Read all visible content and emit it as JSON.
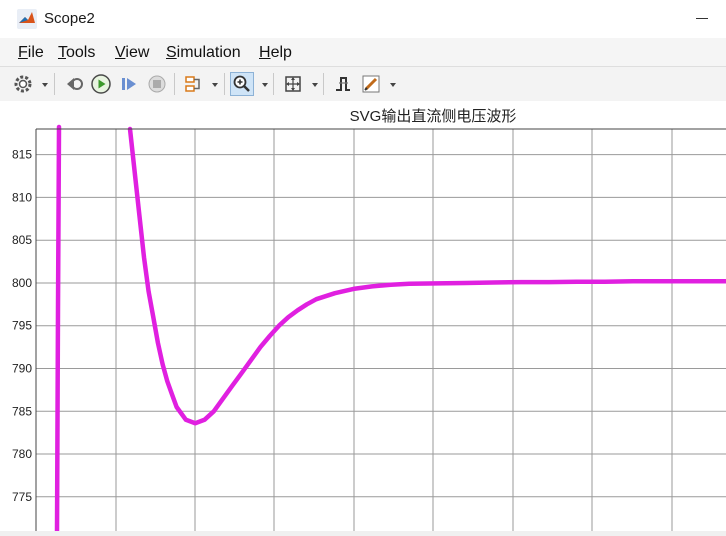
{
  "window": {
    "title": "Scope2",
    "app_icon": "matlab-logo-icon"
  },
  "menu": [
    {
      "label": "File",
      "accel": "F",
      "rest": "ile"
    },
    {
      "label": "Tools",
      "accel": "T",
      "rest": "ools"
    },
    {
      "label": "View",
      "accel": "V",
      "rest": "iew"
    },
    {
      "label": "Simulation",
      "accel": "S",
      "rest": "imulation"
    },
    {
      "label": "Help",
      "accel": "H",
      "rest": "elp"
    }
  ],
  "toolbar": {
    "icons": [
      "gear-icon",
      "step-back-icon",
      "run-icon",
      "step-forward-icon",
      "stop-icon",
      "signal-select-icon",
      "zoom-in-icon",
      "fit-to-view-icon",
      "cursor-measure-icon",
      "style-edit-icon"
    ],
    "active": "zoom-in-icon"
  },
  "chart_data": {
    "type": "line",
    "title": "SVG输出直流侧电压波形",
    "xlabel": "",
    "ylabel": "",
    "ylim": [
      771,
      818
    ],
    "yticks": [
      775,
      780,
      785,
      790,
      795,
      800,
      805,
      810,
      815
    ],
    "grid": true,
    "line_color": "#e020e0",
    "series": [
      {
        "x": [
          0,
          10,
          15,
          20,
          25,
          30,
          35,
          40,
          45,
          50,
          60,
          70,
          80,
          90,
          100,
          110,
          120,
          130,
          140,
          150,
          160,
          170,
          180,
          190,
          200,
          220,
          240,
          260,
          280,
          300,
          330,
          360,
          390,
          420,
          450,
          480,
          510,
          540,
          570,
          600,
          640
        ],
        "y": [
          818,
          808,
          803,
          799,
          796,
          793,
          790.5,
          788.5,
          787,
          785.5,
          784,
          783.6,
          784,
          785,
          786.5,
          788,
          789.5,
          791,
          792.5,
          793.8,
          795,
          796,
          796.8,
          797.5,
          798.1,
          798.8,
          799.3,
          799.6,
          799.8,
          799.9,
          799.95,
          800,
          800.05,
          800.1,
          800.1,
          800.15,
          800.15,
          800.2,
          800.2,
          800.2,
          800.2
        ]
      }
    ]
  }
}
